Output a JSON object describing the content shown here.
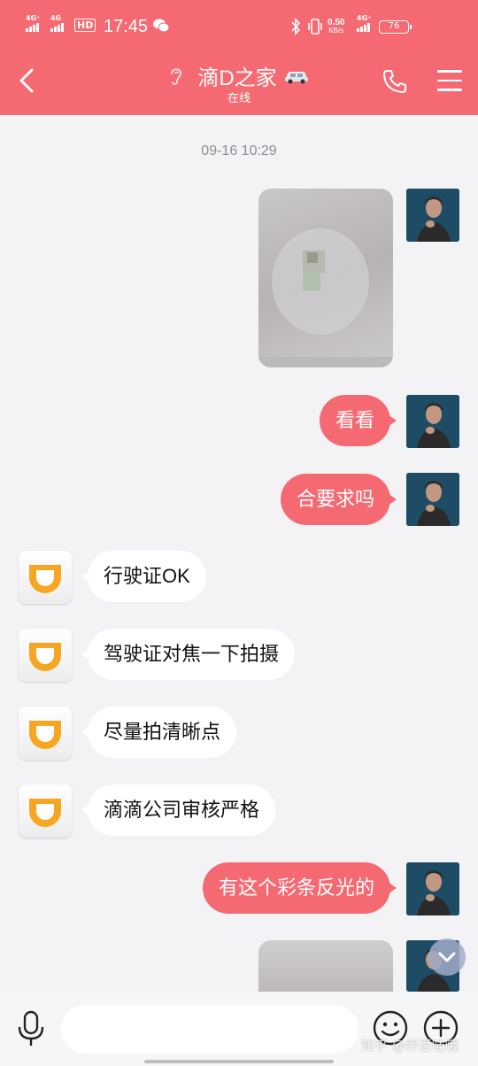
{
  "status_bar": {
    "signal1_label": "4G⁺",
    "signal2_label": "4G",
    "hd_label": "HD",
    "time": "17:45",
    "net_speed_value": "0.50",
    "net_speed_unit": "KB/s",
    "signal3_label": "4G⁺",
    "battery": "76"
  },
  "header": {
    "title": "滴D之家",
    "subtitle": "在线",
    "icons": [
      "back-arrow-icon",
      "ear-icon",
      "car-icon",
      "phone-icon",
      "menu-icon"
    ]
  },
  "chat": {
    "timestamp": "09-16 10:29",
    "messages": [
      {
        "side": "out",
        "type": "image"
      },
      {
        "side": "out",
        "type": "text",
        "text": "看看"
      },
      {
        "side": "out",
        "type": "text",
        "text": "合要求吗"
      },
      {
        "side": "in",
        "type": "text",
        "text": "行驶证OK"
      },
      {
        "side": "in",
        "type": "text",
        "text": "驾驶证对焦一下拍摄"
      },
      {
        "side": "in",
        "type": "text",
        "text": "尽量拍清晰点"
      },
      {
        "side": "in",
        "type": "text",
        "text": "滴滴公司审核严格"
      },
      {
        "side": "out",
        "type": "text",
        "text": "有这个彩条反光的"
      },
      {
        "side": "out",
        "type": "image"
      }
    ]
  },
  "input_bar": {
    "input_value": "",
    "watermark": "知乎 @乔豆哇哦"
  },
  "colors": {
    "accent": "#f56a72",
    "background": "#f3f3f6",
    "incoming_bubble": "#ffffff",
    "didi_orange": "#f6a623"
  }
}
